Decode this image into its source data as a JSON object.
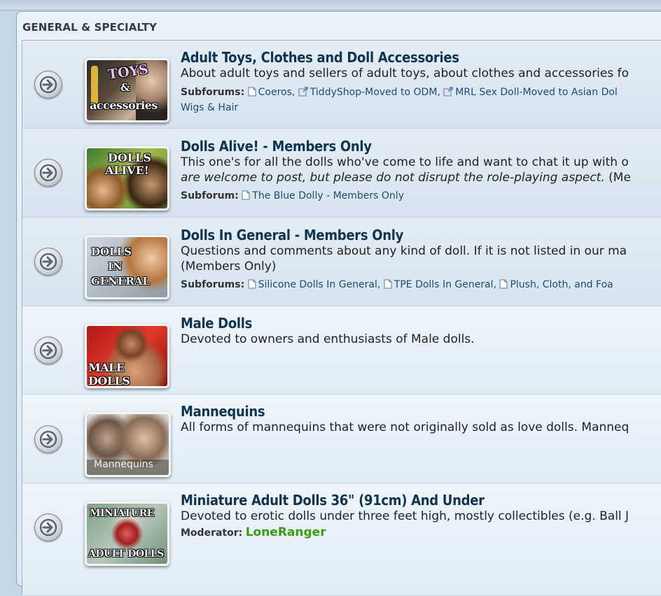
{
  "section_title": "GENERAL & SPECIALTY",
  "forums": [
    {
      "title": "Adult Toys, Clothes and Doll Accessories",
      "description": "About adult toys and sellers of adult toys, about clothes and accessories fo",
      "thumb_label_1": "TOYS",
      "thumb_label_2": "&",
      "thumb_label_3": "accessories",
      "subforums_label": "Subforums:",
      "subforums": [
        "Coeros,",
        "TiddyShop-Moved to ODM,",
        "MRL Sex Doll-Moved to Asian Dol"
      ],
      "subforums_line2": "Wigs & Hair"
    },
    {
      "title": "Dolls Alive! - Members Only",
      "description": "This one's for all the dolls who've come to life and want to chat it up with o",
      "description_italic": "are welcome to post, but please do not disrupt the role-playing aspect.",
      "description_tail": " (Me",
      "thumb_label_1": "DOLLS",
      "thumb_label_2": "ALIVE!",
      "subforums_label": "Subforum:",
      "subforums": [
        "The Blue Dolly - Members Only"
      ]
    },
    {
      "title": "Dolls In General - Members Only",
      "description": "Questions and comments about any kind of doll. If it is not listed in our ma",
      "description_line2": "(Members Only)",
      "thumb_label_1": "DOLLS",
      "thumb_label_2": "IN",
      "thumb_label_3": "GENERAL",
      "subforums_label": "Subforums:",
      "subforums": [
        "Silicone Dolls In General,",
        "TPE Dolls In General,",
        "Plush, Cloth, and Foa"
      ]
    },
    {
      "title": "Male Dolls",
      "description": "Devoted to owners and enthusiasts of Male dolls.",
      "thumb_label_1": "MALE DOLLS"
    },
    {
      "title": "Mannequins",
      "description": "All forms of mannequins that were not originally sold as love dolls. Manneq",
      "thumb_label_1": "Mannequins"
    },
    {
      "title": "Miniature Adult Dolls 36\" (91cm) And Under",
      "description": "Devoted to erotic dolls under three feet high, mostly collectibles (e.g. Ball J",
      "thumb_label_1": "MINIATURE",
      "thumb_label_2": "ADULT DOLLS",
      "moderator_label": "Moderator:",
      "moderator_name": "LoneRanger"
    }
  ],
  "colors": {
    "link": "#10344f",
    "moderator": "#3c9b14",
    "panel_bg": "#e9f1f8"
  }
}
